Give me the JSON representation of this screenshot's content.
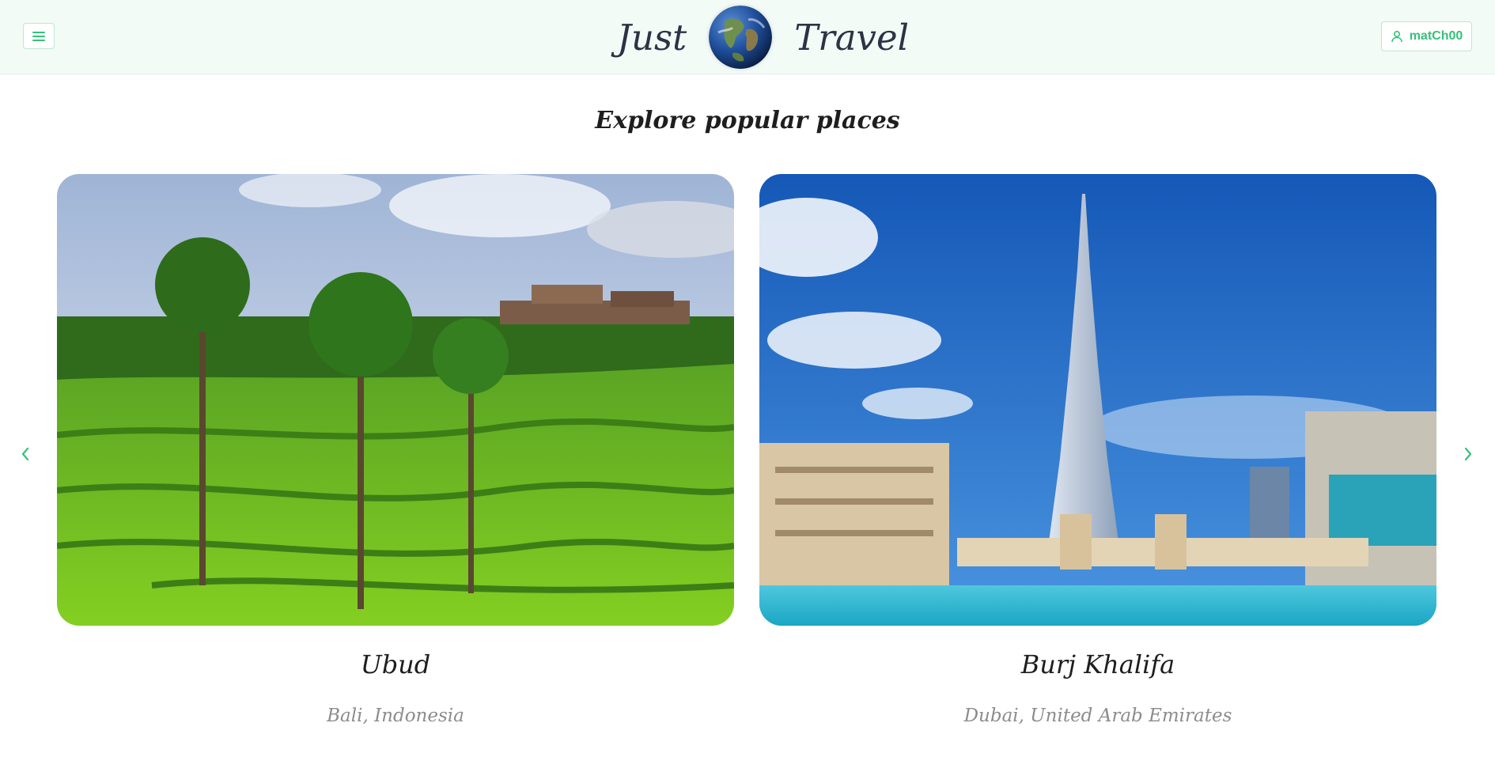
{
  "header": {
    "brand_left": "Just",
    "brand_right": "Travel",
    "user_label": "matCh00",
    "icons": {
      "menu": "hamburger-menu-icon",
      "logo": "earth-globe-icon",
      "user": "user-icon"
    }
  },
  "main": {
    "title": "Explore popular places",
    "carousel": {
      "prev_icon": "chevron-left-icon",
      "next_icon": "chevron-right-icon",
      "cards": [
        {
          "title": "Ubud",
          "subtitle": "Bali, Indonesia"
        },
        {
          "title": "Burj Khalifa",
          "subtitle": "Dubai, United Arab Emirates"
        }
      ]
    }
  },
  "colors": {
    "accent": "#34c27a",
    "header_bg": "#f3fbf7",
    "text": "#1e1e1e",
    "muted_text": "#8c8c8c"
  }
}
